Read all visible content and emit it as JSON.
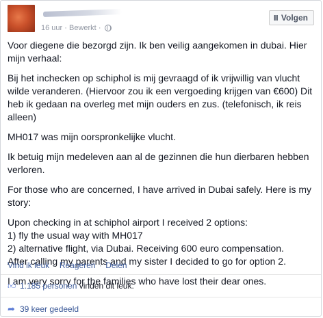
{
  "post": {
    "time": "16 uur",
    "separator": "·",
    "edited": "Bewerkt",
    "audience_icon": "globe-icon",
    "follow_label": "Volgen",
    "follow_icon": "rss-icon",
    "paragraphs": [
      "Voor diegene die bezorgd zijn. Ik ben veilig aangekomen in dubai. Hier mijn verhaal:",
      "Bij het inchecken op schiphol is mij gevraagd of ik vrijwillig van vlucht wilde veranderen. (Hiervoor zou ik een vergoeding krijgen van €600) Dit heb ik gedaan na overleg met mijn ouders en zus. (telefonisch, ik reis alleen)",
      "MH017 was mijn oorspronkelijke vlucht.",
      "Ik betuig mijn medeleven aan al de gezinnen die hun dierbaren hebben verloren.",
      "For those who are concerned, I have arrived in Dubai safely. Here is my story:"
    ],
    "story_lines": [
      "Upon checking in at schiphol airport I received 2 options:",
      "1) fly the usual way with MH017",
      "2) alternative flight, via Dubai. Receiving 600 euro compensation.",
      "After calling my parents and my sister I decided to go for option 2."
    ],
    "closing": "I am very sorry for the families who have lost their dear ones."
  },
  "actions": {
    "like": "Vind ik leuk",
    "react": "Reageren",
    "share": "Delen",
    "separator": "·"
  },
  "stats": {
    "like_icon": "thumbs-up-icon",
    "likes_count": "1.185 personen",
    "likes_suffix": "vinden dit leuk.",
    "share_icon": "share-arrow-icon",
    "shares": "39 keer gedeeld"
  }
}
